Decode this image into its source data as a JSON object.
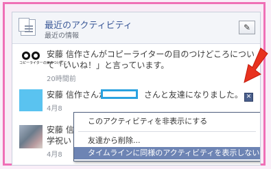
{
  "header": {
    "title": "最近のアクティビティ",
    "subtitle": "最近の情報"
  },
  "activities": [
    {
      "name": "安藤 信作",
      "line1_rest": "さんがコピーライターの目のつけどころについ",
      "line2": "て「いいね！」と言っています。",
      "time": "20時間前",
      "thumb_text": "コピーライターの目のつけどころ"
    },
    {
      "name": "安藤 信作",
      "line1_pre": "さんが",
      "line1_post": "さんと友達になりました。",
      "time": "4月8"
    },
    {
      "name": "安藤 信作",
      "line2": "学祝い",
      "time": "4月8"
    }
  ],
  "menu": {
    "items": [
      "このアクティビティを非表示にする",
      "友達から削除...",
      "タイムラインに同様のアクティビティを表示しない..."
    ]
  },
  "icons": [
    "activity-log-icon",
    "pencil-icon",
    "close-icon",
    "red-arrow-annotation"
  ],
  "colors": {
    "accent": "#3b5998",
    "highlight": "#6d84b4",
    "frame": "#ef6fb6",
    "arrow": "#e8321f"
  }
}
